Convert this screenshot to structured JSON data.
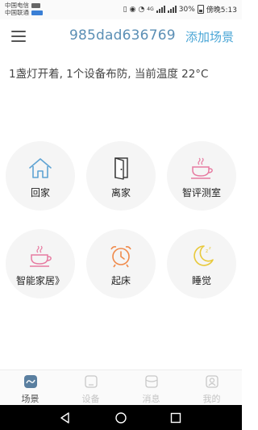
{
  "status_bar": {
    "carrier_1": "中国电信",
    "carrier_2": "中国联通",
    "network": "4G",
    "battery": "30%",
    "time": "傍晚5:13"
  },
  "header": {
    "title": "985dad636769",
    "add_scene_label": "添加场景"
  },
  "status_text": "1盏灯开着, 1个设备布防, 当前温度 22°C",
  "scenes": [
    {
      "label": "回家",
      "icon": "home-icon"
    },
    {
      "label": "离家",
      "icon": "door-icon"
    },
    {
      "label": "智评测室",
      "icon": "cup-icon"
    },
    {
      "label": "智能家居》",
      "icon": "cup-icon"
    },
    {
      "label": "起床",
      "icon": "alarm-clock-icon"
    },
    {
      "label": "睡觉",
      "icon": "moon-icon"
    }
  ],
  "tabs": [
    {
      "label": "场景",
      "icon": "scene-icon",
      "active": true
    },
    {
      "label": "设备",
      "icon": "device-icon",
      "active": false
    },
    {
      "label": "消息",
      "icon": "message-icon",
      "active": false
    },
    {
      "label": "我的",
      "icon": "profile-icon",
      "active": false
    }
  ],
  "colors": {
    "accent": "#4aa6d6",
    "title": "#5b8fb5",
    "home_icon": "#5fa3d3",
    "cup_icon": "#e77ba1",
    "alarm_icon": "#f08a4b",
    "moon_icon": "#e8c93b"
  }
}
